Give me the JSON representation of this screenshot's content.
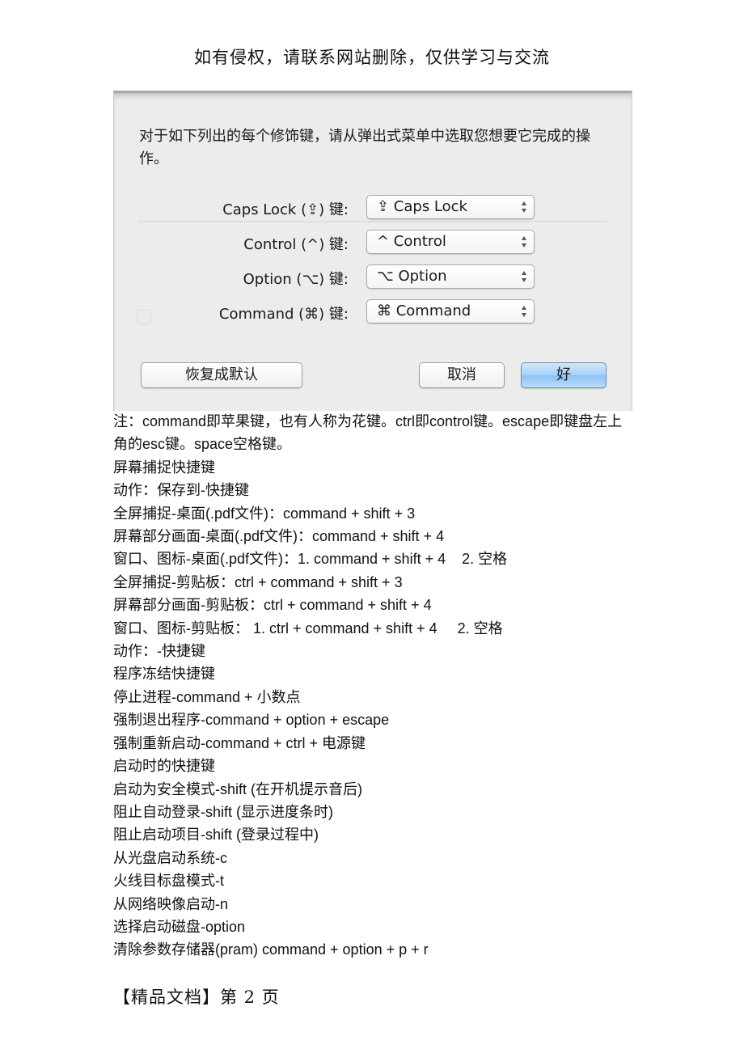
{
  "header_note": "如有侵权，请联系网站删除，仅供学习与交流",
  "dialog": {
    "prompt": "对于如下列出的每个修饰键，请从弹出式菜单中选取您想要它完成的操作。",
    "modifier_rows": [
      {
        "label": "Caps Lock (⇪) 键:",
        "selected": "⇪ Caps Lock",
        "icon": "caps-lock-icon"
      },
      {
        "label": "Control (^) 键:",
        "selected": "^ Control",
        "icon": "control-icon"
      },
      {
        "label": "Option (⌥) 键:",
        "selected": "⌥ Option",
        "icon": "option-icon"
      },
      {
        "label": "Command (⌘) 键:",
        "selected": "⌘ Command",
        "icon": "command-icon"
      }
    ],
    "buttons": {
      "restore_defaults": "恢复成默认",
      "cancel": "取消",
      "ok": "好"
    },
    "accent_color": "#a8d0f8"
  },
  "body_lines": [
    "注：command即苹果键，也有人称为花键。ctrl即control键。escape即键盘左上角的esc键。space空格键。",
    "屏幕捕捉快捷键",
    "动作：保存到-快捷键",
    "全屏捕捉-桌面(.pdf文件)：command + shift + 3",
    "屏幕部分画面-桌面(.pdf文件)：command + shift + 4",
    "窗口、图标-桌面(.pdf文件)：1. command + shift + 4    2. 空格",
    "全屏捕捉-剪贴板：ctrl + command + shift + 3",
    "屏幕部分画面-剪贴板：ctrl + command + shift + 4",
    "窗口、图标-剪贴板： 1. ctrl + command + shift + 4     2. 空格",
    "动作：-快捷键",
    "程序冻结快捷键",
    "停止进程-command + 小数点",
    "强制退出程序-command + option + escape",
    "强制重新启动-command + ctrl + 电源键",
    "启动时的快捷键",
    "启动为安全模式-shift (在开机提示音后)",
    "阻止自动登录-shift (显示进度条时)",
    "阻止启动项目-shift (登录过程中)",
    "从光盘启动系统-c",
    "火线目标盘模式-t",
    "从网络映像启动-n",
    "选择启动磁盘-option",
    "清除参数存储器(pram) command + option + p + r"
  ],
  "footer": "【精品文档】第 2 页"
}
